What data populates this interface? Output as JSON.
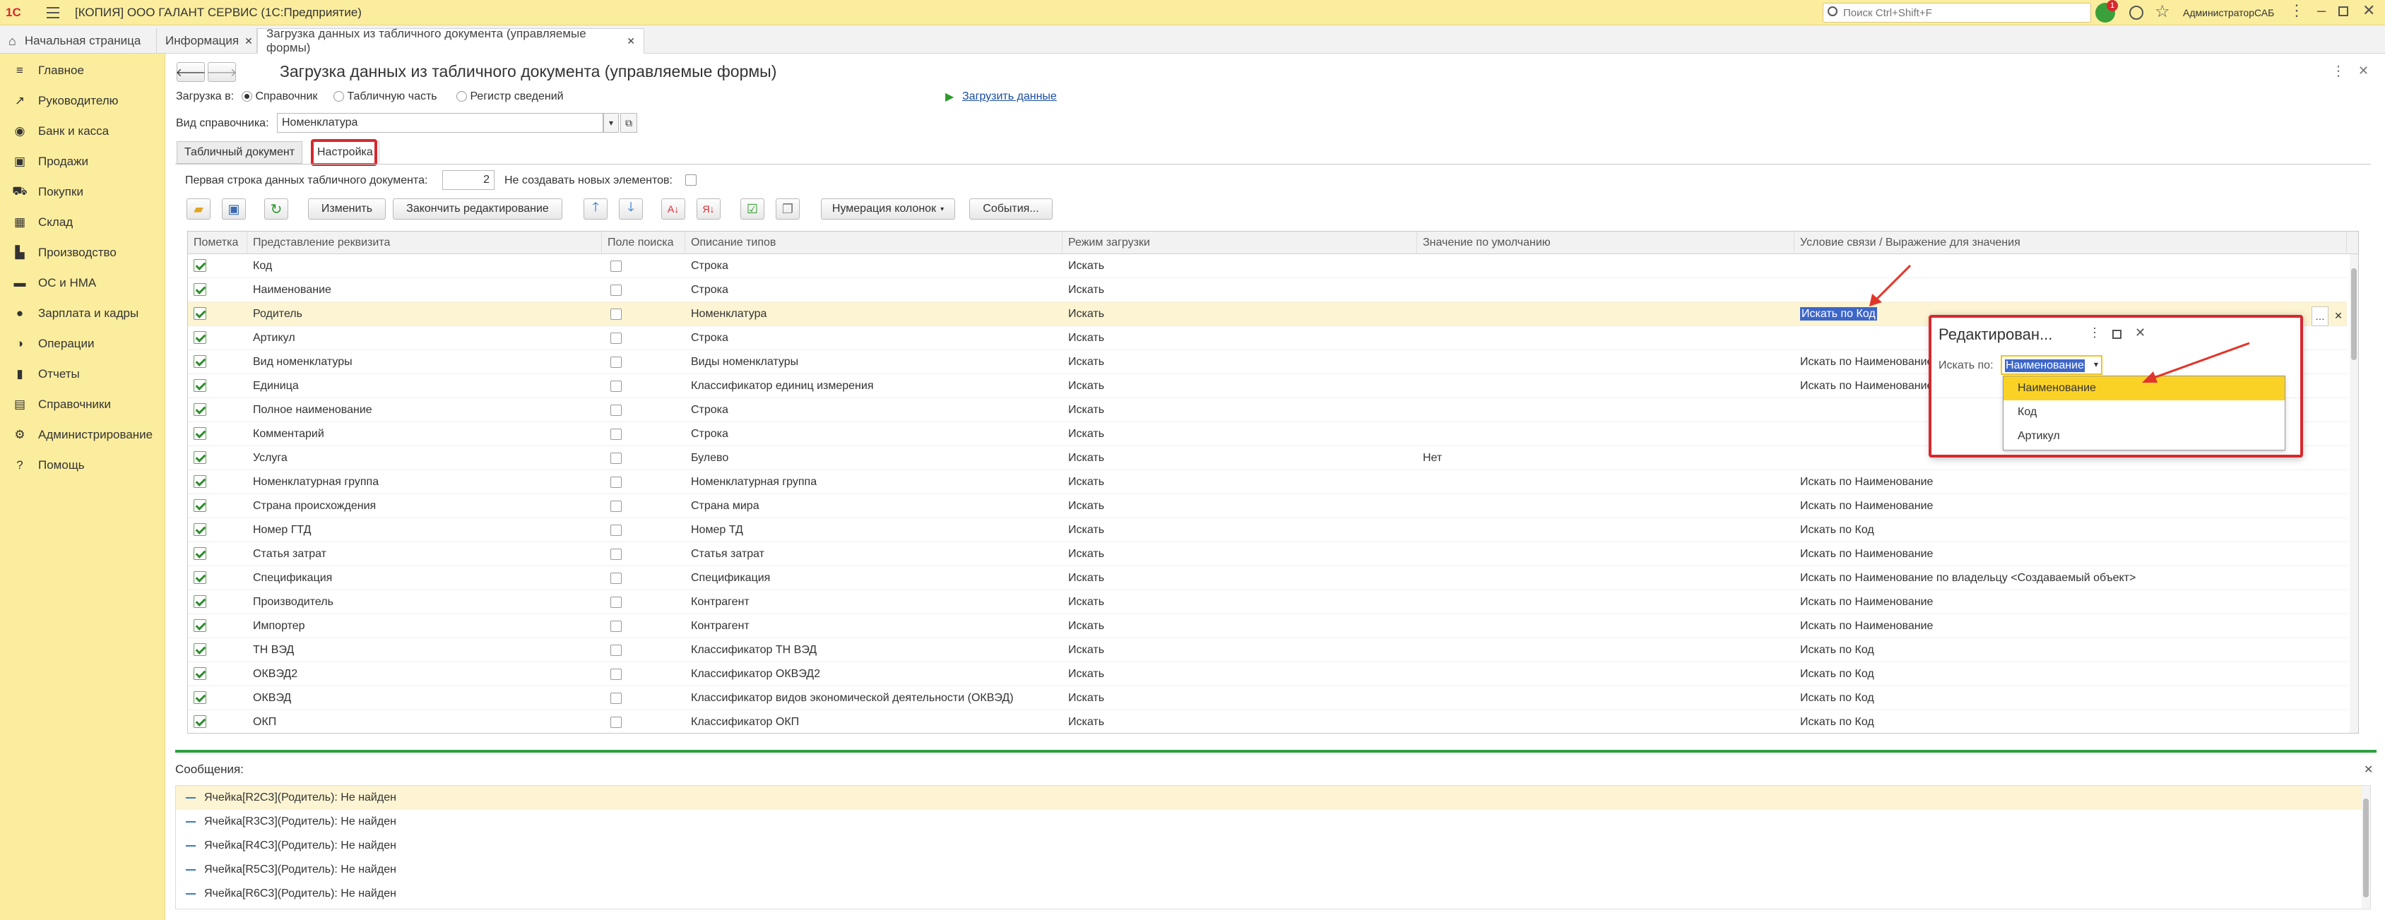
{
  "window": {
    "app_title": "[КОПИЯ] ООО ГАЛАНТ СЕРВИС  (1С:Предприятие)",
    "search_placeholder": "Поиск Ctrl+Shift+F",
    "notification_count": "1",
    "user": "АдминистраторСАБ"
  },
  "tabs": [
    {
      "label": "Начальная страница"
    },
    {
      "label": "Информация"
    },
    {
      "label": "Загрузка данных из табличного документа (управляемые формы)"
    }
  ],
  "sidebar": {
    "items": [
      {
        "label": "Главное",
        "icon": "menu-icon"
      },
      {
        "label": "Руководителю",
        "icon": "chart-line-icon"
      },
      {
        "label": "Банк и касса",
        "icon": "coins-icon"
      },
      {
        "label": "Продажи",
        "icon": "bag-icon"
      },
      {
        "label": "Покупки",
        "icon": "cart-icon"
      },
      {
        "label": "Склад",
        "icon": "warehouse-icon"
      },
      {
        "label": "Производство",
        "icon": "factory-icon"
      },
      {
        "label": "ОС и НМА",
        "icon": "truck-icon"
      },
      {
        "label": "Зарплата и кадры",
        "icon": "person-icon"
      },
      {
        "label": "Операции",
        "icon": "operations-icon"
      },
      {
        "label": "Отчеты",
        "icon": "bar-chart-icon"
      },
      {
        "label": "Справочники",
        "icon": "book-icon"
      },
      {
        "label": "Администрирование",
        "icon": "gear-icon"
      },
      {
        "label": "Помощь",
        "icon": "help-icon"
      }
    ]
  },
  "form": {
    "title": "Загрузка данных из табличного документа (управляемые формы)",
    "load_to_label": "Загрузка в:",
    "load_to_options": [
      "Справочник",
      "Табличную часть",
      "Регистр сведений"
    ],
    "load_data_link": "Загрузить данные",
    "catalog_label": "Вид справочника:",
    "catalog_value": "Номенклатура",
    "subtabs": [
      "Табличный документ",
      "Настройка"
    ],
    "first_row_label": "Первая строка данных табличного документа:",
    "first_row_value": "2",
    "no_new_label": "Не создавать новых элементов:",
    "toolbar": {
      "edit": "Изменить",
      "finish_edit": "Закончить редактирование",
      "numbering": "Нумерация колонок",
      "events": "События..."
    }
  },
  "grid": {
    "columns": [
      "Пометка",
      "Представление реквизита",
      "Поле поиска",
      "Описание типов",
      "Режим загрузки",
      "Значение по умолчанию",
      "Условие связи / Выражение для значения"
    ],
    "rows": [
      {
        "name": "Код",
        "type": "Строка",
        "mode": "Искать",
        "default": "",
        "condition": ""
      },
      {
        "name": "Наименование",
        "type": "Строка",
        "mode": "Искать",
        "default": "",
        "condition": ""
      },
      {
        "name": "Родитель",
        "type": "Номенклатура",
        "mode": "Искать",
        "default": "",
        "condition": "Искать по Код"
      },
      {
        "name": "Артикул",
        "type": "Строка",
        "mode": "Искать",
        "default": "",
        "condition": ""
      },
      {
        "name": "Вид номенклатуры",
        "type": "Виды номенклатуры",
        "mode": "Искать",
        "default": "",
        "condition": "Искать по Наименование"
      },
      {
        "name": "Единица",
        "type": "Классификатор единиц измерения",
        "mode": "Искать",
        "default": "",
        "condition": "Искать по Наименование"
      },
      {
        "name": "Полное наименование",
        "type": "Строка",
        "mode": "Искать",
        "default": "",
        "condition": ""
      },
      {
        "name": "Комментарий",
        "type": "Строка",
        "mode": "Искать",
        "default": "",
        "condition": ""
      },
      {
        "name": "Услуга",
        "type": "Булево",
        "mode": "Искать",
        "default": "Нет",
        "condition": ""
      },
      {
        "name": "Номенклатурная группа",
        "type": "Номенклатурная группа",
        "mode": "Искать",
        "default": "",
        "condition": "Искать по Наименование"
      },
      {
        "name": "Страна происхождения",
        "type": "Страна мира",
        "mode": "Искать",
        "default": "",
        "condition": "Искать по Наименование"
      },
      {
        "name": "Номер ГТД",
        "type": "Номер ТД",
        "mode": "Искать",
        "default": "",
        "condition": "Искать по Код"
      },
      {
        "name": "Статья затрат",
        "type": "Статья затрат",
        "mode": "Искать",
        "default": "",
        "condition": "Искать по Наименование"
      },
      {
        "name": "Спецификация",
        "type": "Спецификация",
        "mode": "Искать",
        "default": "",
        "condition": "Искать по Наименование по владельцу <Создаваемый объект>"
      },
      {
        "name": "Производитель",
        "type": "Контрагент",
        "mode": "Искать",
        "default": "",
        "condition": "Искать по Наименование"
      },
      {
        "name": "Импортер",
        "type": "Контрагент",
        "mode": "Искать",
        "default": "",
        "condition": "Искать по Наименование"
      },
      {
        "name": "ТН ВЭД",
        "type": "Классификатор ТН ВЭД",
        "mode": "Искать",
        "default": "",
        "condition": "Искать по Код"
      },
      {
        "name": "ОКВЭД2",
        "type": "Классификатор ОКВЭД2",
        "mode": "Искать",
        "default": "",
        "condition": "Искать по Код"
      },
      {
        "name": "ОКВЭД",
        "type": "Классификатор видов экономической деятельности (ОКВЭД)",
        "mode": "Искать",
        "default": "",
        "condition": "Искать по Код"
      },
      {
        "name": "ОКП",
        "type": "Классификатор ОКП",
        "mode": "Искать",
        "default": "",
        "condition": "Искать по Код"
      }
    ]
  },
  "dialog": {
    "title": "Редактирован...",
    "search_label": "Искать по:",
    "search_value": "Наименование",
    "options": [
      "Наименование",
      "Код",
      "Артикул"
    ]
  },
  "messages": {
    "title": "Сообщения:",
    "items": [
      "Ячейка[R2C3](Родитель): Не найден",
      "Ячейка[R3C3](Родитель): Не найден",
      "Ячейка[R4C3](Родитель): Не найден",
      "Ячейка[R5C3](Родитель): Не найден",
      "Ячейка[R6C3](Родитель): Не найден"
    ]
  },
  "colors": {
    "accent": "#fbed9e",
    "highlight_red": "#d7282f",
    "selection": "#fad225",
    "link": "#1a4ea2"
  }
}
